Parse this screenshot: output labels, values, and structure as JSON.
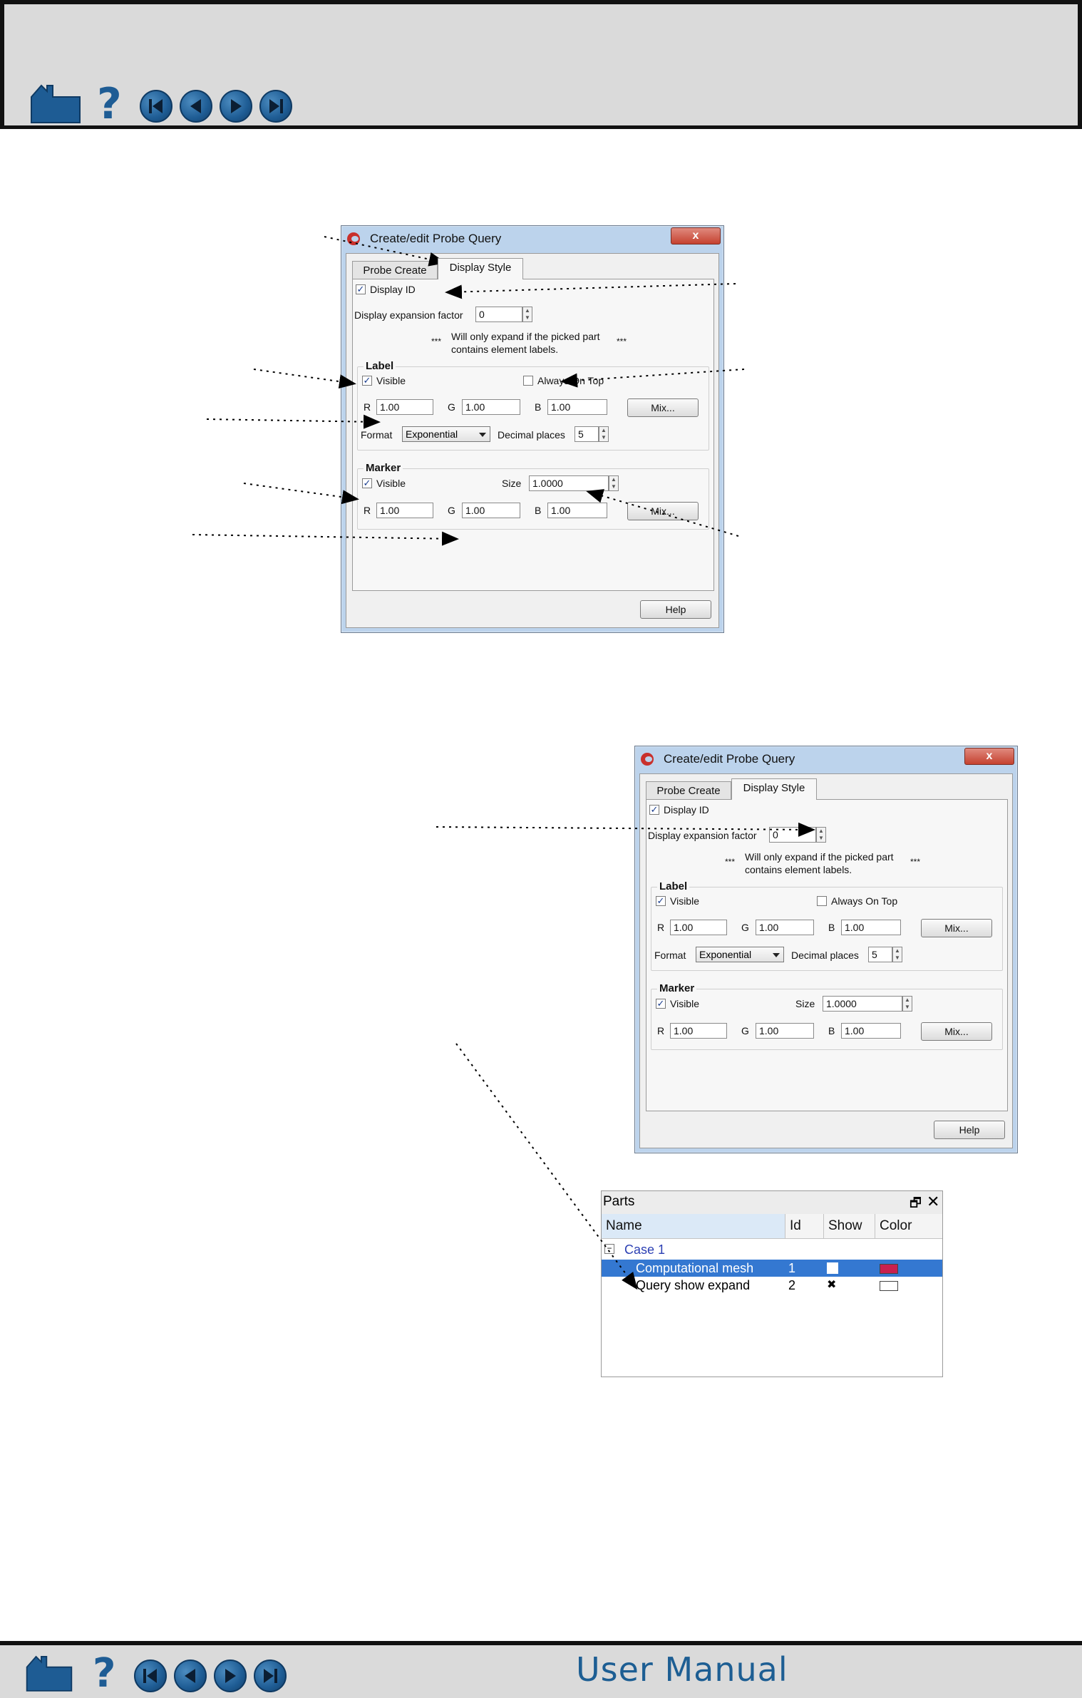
{
  "header": {
    "nav_icons": [
      "home-icon",
      "help-icon",
      "first-page-icon",
      "previous-page-icon",
      "next-page-icon",
      "last-page-icon"
    ]
  },
  "footer": {
    "title": "User Manual",
    "nav_icons": [
      "home-icon",
      "help-icon",
      "first-page-icon",
      "previous-page-icon",
      "next-page-icon",
      "last-page-icon"
    ]
  },
  "dialog": {
    "title": "Create/edit Probe Query",
    "close_label": "x",
    "tabs": [
      "Probe Create",
      "Display Style"
    ],
    "active_tab": "Display Style",
    "display_id_label": "Display ID",
    "display_id_checked": true,
    "expansion_label": "Display expansion factor",
    "expansion_value": "0",
    "note_line1": "Will only expand if the picked part",
    "note_line2": "contains element labels.",
    "note_stars": "***",
    "label_group": {
      "title": "Label",
      "visible_label": "Visible",
      "visible_checked": true,
      "always_on_top_label": "Always On Top",
      "always_on_top_checked": false,
      "r_label": "R",
      "r_value": "1.00",
      "g_label": "G",
      "g_value": "1.00",
      "b_label": "B",
      "b_value": "1.00",
      "mix_label": "Mix...",
      "format_label": "Format",
      "format_value": "Exponential",
      "decimal_label": "Decimal places",
      "decimal_value": "5"
    },
    "marker_group": {
      "title": "Marker",
      "visible_label": "Visible",
      "visible_checked": true,
      "size_label": "Size",
      "size_value": "1.0000",
      "r_label": "R",
      "r_value": "1.00",
      "g_label": "G",
      "g_value": "1.00",
      "b_label": "B",
      "b_value": "1.00",
      "mix_label": "Mix..."
    },
    "help_label": "Help"
  },
  "parts_panel": {
    "title": "Parts",
    "columns": [
      "Name",
      "Id",
      "Show",
      "Color"
    ],
    "case_label": "Case 1",
    "rows": [
      {
        "name": "Computational mesh",
        "id": "1",
        "show": "",
        "color": "#c8204f",
        "selected": true
      },
      {
        "name": "Query show expand",
        "id": "2",
        "show": "✖",
        "color": "#ffffff",
        "selected": false
      }
    ]
  }
}
